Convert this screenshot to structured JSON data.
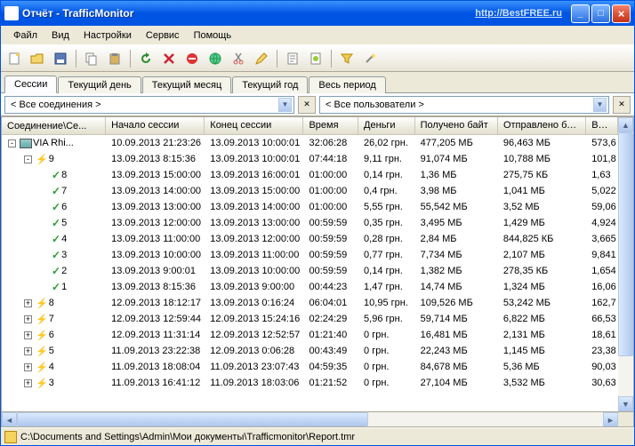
{
  "titlebar": {
    "title": "Отчёт - TrafficMonitor",
    "link": "http://BestFREE.ru"
  },
  "menu": {
    "file": "Файл",
    "view": "Вид",
    "settings": "Настройки",
    "service": "Сервис",
    "help": "Помощь"
  },
  "tabs": {
    "sessions": "Сессии",
    "today": "Текущий день",
    "month": "Текущий месяц",
    "year": "Текущий год",
    "all": "Весь период"
  },
  "filters": {
    "conn_prefix": "<",
    "conn": "Все соединения",
    "conn_suffix": ">",
    "user_prefix": "<",
    "user": "Все пользователи",
    "user_suffix": ">"
  },
  "columns": {
    "c0": "Соединение\\Се...",
    "c1": "Начало сессии",
    "c2": "Конец сессии",
    "c3": "Время",
    "c4": "Деньги",
    "c5": "Получено байт",
    "c6": "Отправлено байт",
    "c7": "Все..."
  },
  "rows": [
    {
      "level": 0,
      "exp": "-",
      "icon": "pc",
      "label": "VIA Rhi...",
      "start": "10.09.2013 21:23:26",
      "end": "13.09.2013 10:00:01",
      "time": "32:06:28",
      "money": "26,02 грн.",
      "recv": "477,205 МБ",
      "sent": "96,463 МБ",
      "all": "573,6"
    },
    {
      "level": 1,
      "exp": "-",
      "icon": "bolt",
      "label": "9",
      "start": "13.09.2013 8:15:36",
      "end": "13.09.2013 10:00:01",
      "time": "07:44:18",
      "money": "9,11 грн.",
      "recv": "91,074 МБ",
      "sent": "10,788 МБ",
      "all": "101,8"
    },
    {
      "level": 2,
      "exp": "",
      "icon": "check",
      "label": "8",
      "start": "13.09.2013 15:00:00",
      "end": "13.09.2013 16:00:01",
      "time": "01:00:00",
      "money": "0,14 грн.",
      "recv": "1,36 МБ",
      "sent": "275,75 КБ",
      "all": "1,63"
    },
    {
      "level": 2,
      "exp": "",
      "icon": "check",
      "label": "7",
      "start": "13.09.2013 14:00:00",
      "end": "13.09.2013 15:00:00",
      "time": "01:00:00",
      "money": "0,4 грн.",
      "recv": "3,98 МБ",
      "sent": "1,041 МБ",
      "all": "5,022"
    },
    {
      "level": 2,
      "exp": "",
      "icon": "check",
      "label": "6",
      "start": "13.09.2013 13:00:00",
      "end": "13.09.2013 14:00:00",
      "time": "01:00:00",
      "money": "5,55 грн.",
      "recv": "55,542 МБ",
      "sent": "3,52 МБ",
      "all": "59,06"
    },
    {
      "level": 2,
      "exp": "",
      "icon": "check",
      "label": "5",
      "start": "13.09.2013 12:00:00",
      "end": "13.09.2013 13:00:00",
      "time": "00:59:59",
      "money": "0,35 грн.",
      "recv": "3,495 МБ",
      "sent": "1,429 МБ",
      "all": "4,924"
    },
    {
      "level": 2,
      "exp": "",
      "icon": "check",
      "label": "4",
      "start": "13.09.2013 11:00:00",
      "end": "13.09.2013 12:00:00",
      "time": "00:59:59",
      "money": "0,28 грн.",
      "recv": "2,84 МБ",
      "sent": "844,825 КБ",
      "all": "3,665"
    },
    {
      "level": 2,
      "exp": "",
      "icon": "check",
      "label": "3",
      "start": "13.09.2013 10:00:00",
      "end": "13.09.2013 11:00:00",
      "time": "00:59:59",
      "money": "0,77 грн.",
      "recv": "7,734 МБ",
      "sent": "2,107 МБ",
      "all": "9,841"
    },
    {
      "level": 2,
      "exp": "",
      "icon": "check",
      "label": "2",
      "start": "13.09.2013 9:00:01",
      "end": "13.09.2013 10:00:00",
      "time": "00:59:59",
      "money": "0,14 грн.",
      "recv": "1,382 МБ",
      "sent": "278,35 КБ",
      "all": "1,654"
    },
    {
      "level": 2,
      "exp": "",
      "icon": "check",
      "label": "1",
      "start": "13.09.2013 8:15:36",
      "end": "13.09.2013 9:00:00",
      "time": "00:44:23",
      "money": "1,47 грн.",
      "recv": "14,74 МБ",
      "sent": "1,324 МБ",
      "all": "16,06"
    },
    {
      "level": 1,
      "exp": "+",
      "icon": "bolt",
      "label": "8",
      "start": "12.09.2013 18:12:17",
      "end": "13.09.2013 0:16:24",
      "time": "06:04:01",
      "money": "10,95 грн.",
      "recv": "109,526 МБ",
      "sent": "53,242 МБ",
      "all": "162,7"
    },
    {
      "level": 1,
      "exp": "+",
      "icon": "bolt",
      "label": "7",
      "start": "12.09.2013 12:59:44",
      "end": "12.09.2013 15:24:16",
      "time": "02:24:29",
      "money": "5,96 грн.",
      "recv": "59,714 МБ",
      "sent": "6,822 МБ",
      "all": "66,53"
    },
    {
      "level": 1,
      "exp": "+",
      "icon": "bolt",
      "label": "6",
      "start": "12.09.2013 11:31:14",
      "end": "12.09.2013 12:52:57",
      "time": "01:21:40",
      "money": "0 грн.",
      "recv": "16,481 МБ",
      "sent": "2,131 МБ",
      "all": "18,61"
    },
    {
      "level": 1,
      "exp": "+",
      "icon": "bolt",
      "label": "5",
      "start": "11.09.2013 23:22:38",
      "end": "12.09.2013 0:06:28",
      "time": "00:43:49",
      "money": "0 грн.",
      "recv": "22,243 МБ",
      "sent": "1,145 МБ",
      "all": "23,38"
    },
    {
      "level": 1,
      "exp": "+",
      "icon": "bolt",
      "label": "4",
      "start": "11.09.2013 18:08:04",
      "end": "11.09.2013 23:07:43",
      "time": "04:59:35",
      "money": "0 грн.",
      "recv": "84,678 МБ",
      "sent": "5,36 МБ",
      "all": "90,03"
    },
    {
      "level": 1,
      "exp": "+",
      "icon": "bolt",
      "label": "3",
      "start": "11.09.2013 16:41:12",
      "end": "11.09.2013 18:03:06",
      "time": "01:21:52",
      "money": "0 грн.",
      "recv": "27,104 МБ",
      "sent": "3,532 МБ",
      "all": "30,63"
    }
  ],
  "statusbar": {
    "path": "C:\\Documents and Settings\\Admin\\Мои документы\\Trafficmonitor\\Report.tmr"
  }
}
